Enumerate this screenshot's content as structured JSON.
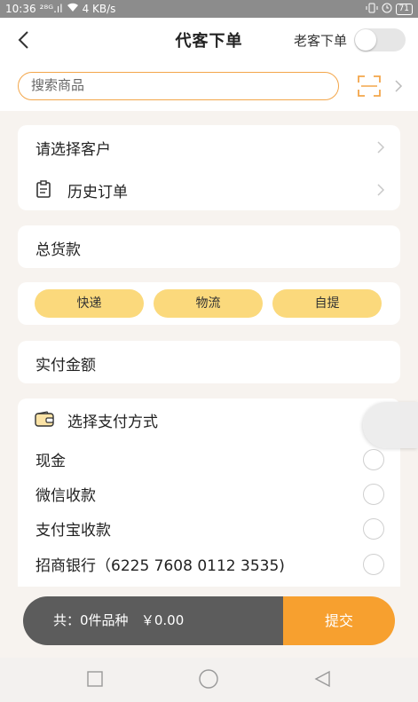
{
  "status_bar": {
    "time": "10:36",
    "signal": "²⁸ᴳ.ıl",
    "speed": "4 KB/s",
    "battery": "71"
  },
  "nav": {
    "title": "代客下单",
    "old_customer_label": "老客下单"
  },
  "search": {
    "placeholder": "搜索商品"
  },
  "customer": {
    "select_label": "请选择客户",
    "history_label": "历史订单"
  },
  "total_goods_label": "总货款",
  "shipping": {
    "options": [
      "快递",
      "物流",
      "自提"
    ]
  },
  "paid_amount_label": "实付金额",
  "payment": {
    "title": "选择支付方式",
    "methods": [
      "现金",
      "微信收款",
      "支付宝收款",
      "招商银行（6225 7608 0112 3535)"
    ]
  },
  "footer": {
    "summary": "共：0件品种   ￥0.00",
    "submit_label": "提交"
  },
  "colors": {
    "accent": "#f7a02f",
    "chip": "#fbd97c",
    "summary_bg": "#5c5c5c"
  }
}
